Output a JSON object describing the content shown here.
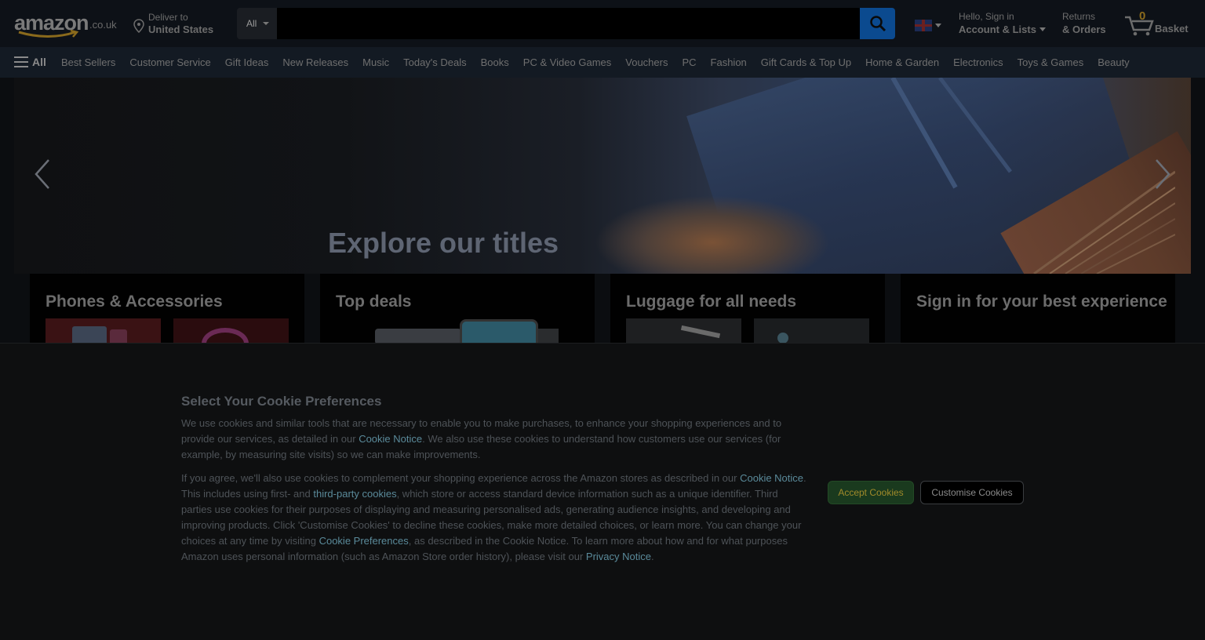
{
  "header": {
    "logo_text": "amazon",
    "logo_tld": ".co.uk",
    "deliver_line1": "Deliver to",
    "deliver_line2": "United States",
    "search_category": "All",
    "search_placeholder": "",
    "account_line1": "Hello, Sign in",
    "account_line2": "Account & Lists",
    "returns_line1": "Returns",
    "returns_line2": "& Orders",
    "basket_count": "0",
    "basket_label": "Basket"
  },
  "nav": {
    "all_label": "All",
    "links": [
      "Best Sellers",
      "Customer Service",
      "Gift Ideas",
      "New Releases",
      "Music",
      "Today's Deals",
      "Books",
      "PC & Video Games",
      "Vouchers",
      "PC",
      "Fashion",
      "Gift Cards & Top Up",
      "Home & Garden",
      "Electronics",
      "Toys & Games",
      "Beauty"
    ]
  },
  "hero": {
    "title": "Explore our titles"
  },
  "cards": [
    {
      "title": "Phones & Accessories"
    },
    {
      "title": "Top deals"
    },
    {
      "title": "Luggage for all needs"
    },
    {
      "title": "Sign in for your best experience"
    }
  ],
  "cookie": {
    "title": "Select Your Cookie Preferences",
    "p1_a": "We use cookies and similar tools that are necessary to enable you to make purchases, to enhance your shopping experiences and to provide our services, as detailed in our ",
    "p1_link": "Cookie Notice",
    "p1_b": ". We also use these cookies to understand how customers use our services (for example, by measuring site visits) so we can make improvements.",
    "p2_a": "If you agree, we'll also use cookies to complement your shopping experience across the Amazon stores as described in our ",
    "p2_link1": "Cookie Notice",
    "p2_b": ". This includes using first- and ",
    "p2_link2": "third-party cookies",
    "p2_c": ", which store or access standard device information such as a unique identifier. Third parties use cookies for their purposes of displaying and measuring personalised ads, generating audience insights, and developing and improving products. Click 'Customise Cookies' to decline these cookies, make more detailed choices, or learn more. You can change your choices at any time by visiting ",
    "p2_link3": "Cookie Preferences",
    "p2_d": ", as described in the Cookie Notice. To learn more about how and for what purposes Amazon uses personal information (such as Amazon Store order history), please visit our ",
    "p2_link4": "Privacy Notice",
    "p2_e": ".",
    "accept_label": "Accept Cookies",
    "customise_label": "Customise Cookies"
  },
  "colors": {
    "search_button": "#0b4a8f",
    "accept_button": "#1a3a1e",
    "link": "#5a8a9a"
  }
}
